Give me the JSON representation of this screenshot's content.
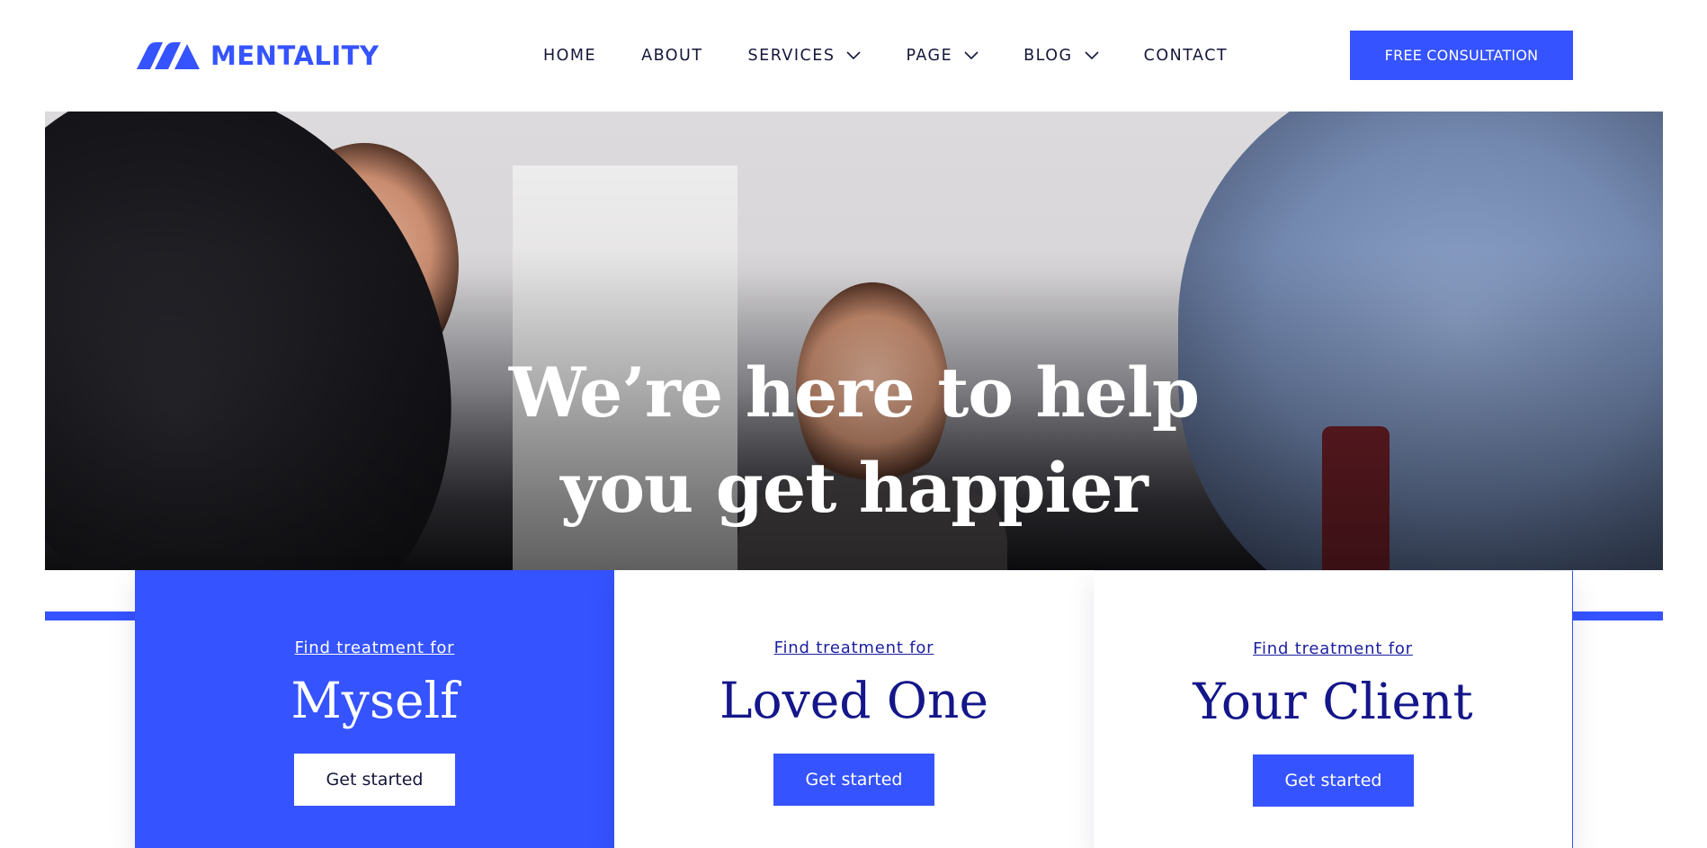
{
  "brand": {
    "name": "MENTALITY",
    "logo_icon": "mentality-logo-mark",
    "color": "#3553ff"
  },
  "nav": {
    "items": [
      {
        "label": "HOME",
        "has_dropdown": false
      },
      {
        "label": "ABOUT",
        "has_dropdown": false
      },
      {
        "label": "SERVICES",
        "has_dropdown": true
      },
      {
        "label": "PAGE",
        "has_dropdown": true
      },
      {
        "label": "BLOG",
        "has_dropdown": true
      },
      {
        "label": "CONTACT",
        "has_dropdown": false
      }
    ],
    "dropdown_icon": "chevron-down-icon"
  },
  "header": {
    "cta_label": "FREE CONSULTATION"
  },
  "hero": {
    "title_line1": "We’re here to help",
    "title_line2": "you get happier"
  },
  "cards": [
    {
      "kicker": "Find treatment for",
      "title": "Myself",
      "button": "Get started",
      "active": true
    },
    {
      "kicker": "Find treatment for",
      "title": "Loved One",
      "button": "Get started",
      "active": false
    },
    {
      "kicker": "Find treatment for",
      "title": "Your Client",
      "button": "Get started",
      "active": false
    }
  ],
  "colors": {
    "accent": "#3553ff",
    "heading_dark": "#14168a",
    "text_dark": "#14163a"
  }
}
